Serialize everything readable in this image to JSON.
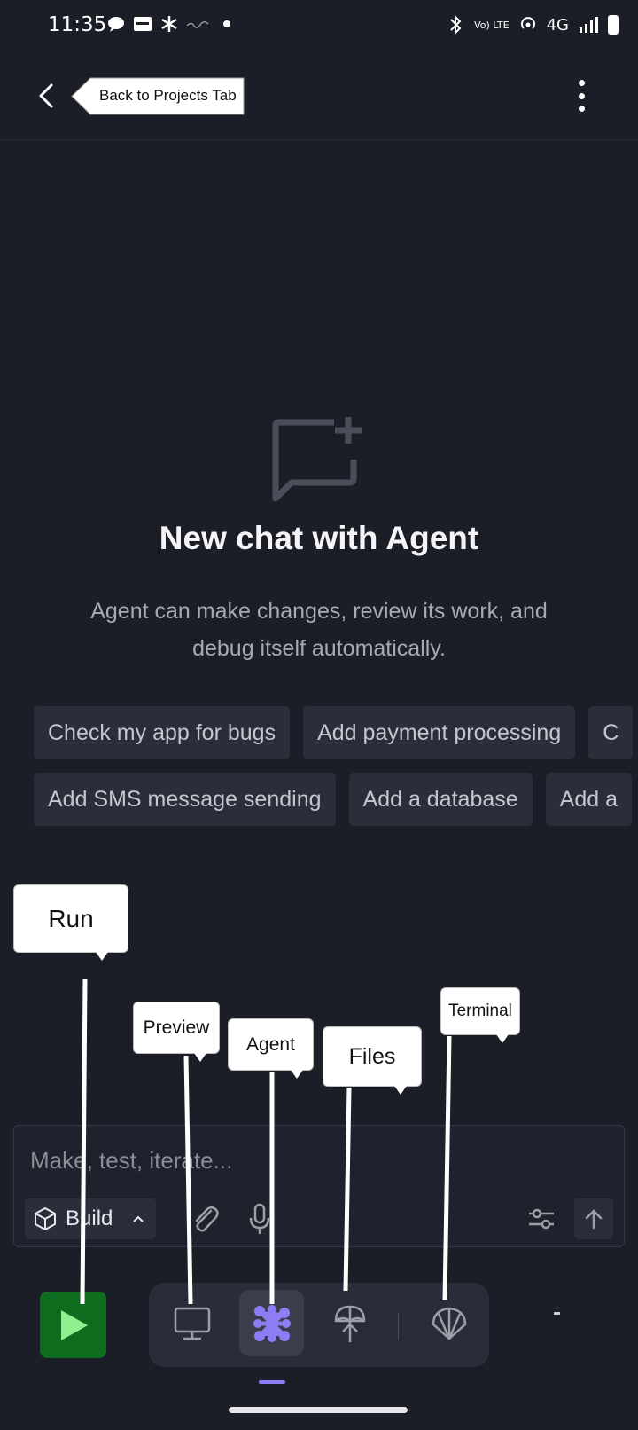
{
  "status_bar": {
    "time": "11:35",
    "network": "4G",
    "volte": "Vo) LTE"
  },
  "header": {
    "back_tooltip": "Back to Projects Tab"
  },
  "empty_state": {
    "title": "New chat with Agent",
    "description": "Agent can make changes, review its work, and debug itself automatically."
  },
  "suggestions": {
    "row1": [
      "Check my app for bugs",
      "Add payment processing",
      "C"
    ],
    "row2": [
      "Add SMS message sending",
      "Add a database",
      "Add a"
    ]
  },
  "tooltips": {
    "run": "Run",
    "preview": "Preview",
    "agent": "Agent",
    "files": "Files",
    "terminal": "Terminal"
  },
  "composer": {
    "placeholder": "Make, test, iterate...",
    "mode_label": "Build"
  },
  "nav": {
    "items": [
      "preview-icon",
      "agent-icon",
      "files-icon",
      "terminal-icon"
    ]
  },
  "colors": {
    "background": "#1c1e27",
    "run_green": "#0d6c1e",
    "agent_purple": "#8d7cf3"
  }
}
